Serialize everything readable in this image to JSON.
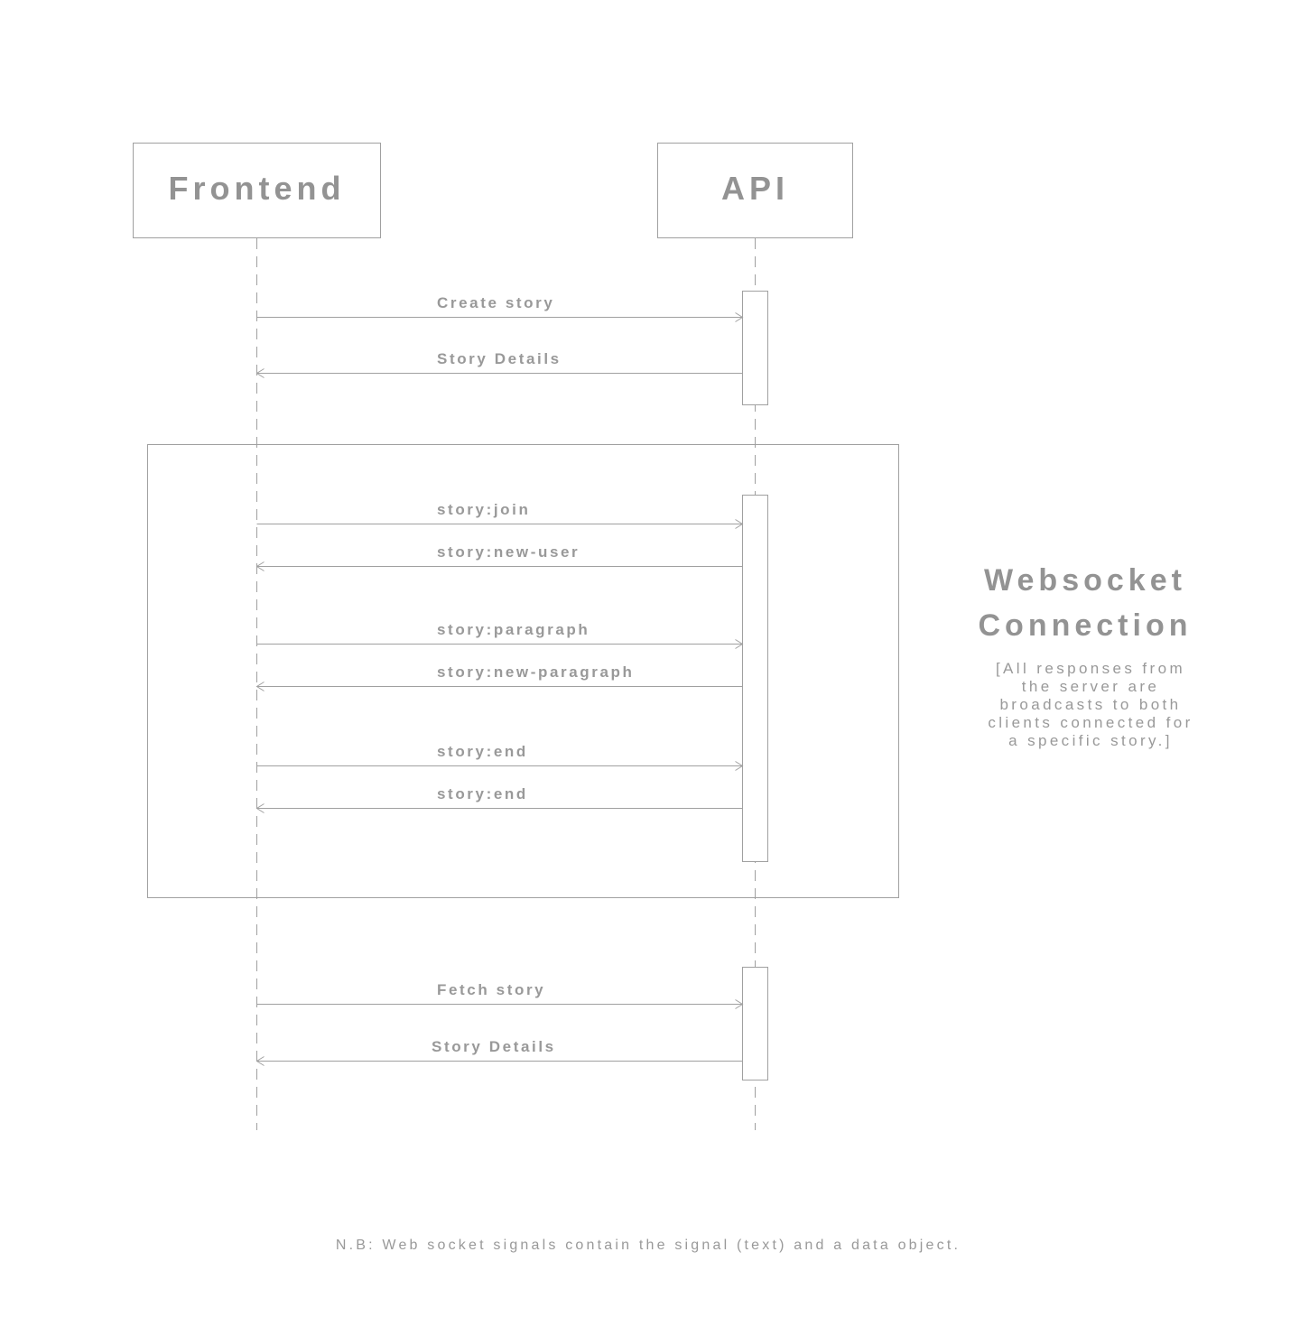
{
  "participants": [
    {
      "name": "Frontend"
    },
    {
      "name": "API"
    }
  ],
  "messages": [
    {
      "label": "Create story",
      "from": "Frontend",
      "to": "API"
    },
    {
      "label": "Story Details",
      "from": "API",
      "to": "Frontend"
    },
    {
      "label": "story:join",
      "from": "Frontend",
      "to": "API"
    },
    {
      "label": "story:new-user",
      "from": "API",
      "to": "Frontend"
    },
    {
      "label": "story:paragraph",
      "from": "Frontend",
      "to": "API"
    },
    {
      "label": "story:new-paragraph",
      "from": "API",
      "to": "Frontend"
    },
    {
      "label": "story:end",
      "from": "Frontend",
      "to": "API"
    },
    {
      "label": "story:end",
      "from": "API",
      "to": "Frontend"
    },
    {
      "label": "Fetch story",
      "from": "Frontend",
      "to": "API"
    },
    {
      "label": "Story Details",
      "from": "API",
      "to": "Frontend"
    }
  ],
  "group": {
    "title_lines": [
      "Websocket",
      "Connection"
    ],
    "note_lines": [
      "[All responses from",
      "the server are",
      "broadcasts to both",
      "clients connected for",
      "a specific story.]"
    ]
  },
  "footnote": "N.B: Web socket signals contain the signal (text) and a data object.",
  "colors": {
    "line": "#a0a0a0",
    "text": "#999999"
  }
}
